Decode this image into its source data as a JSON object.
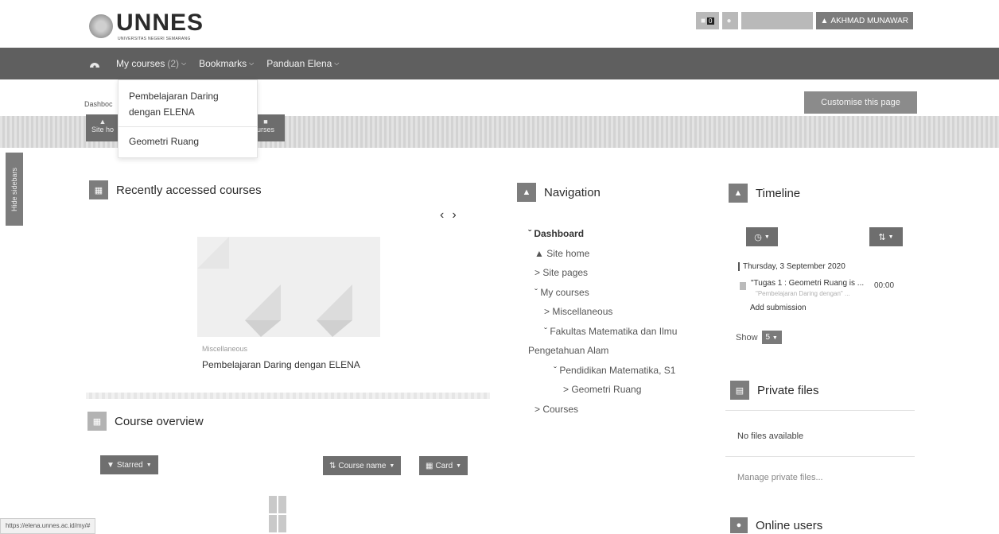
{
  "header": {
    "logo_word": "UNNES",
    "logo_sub": "UNIVERSITAS NEGERI SEMARANG",
    "notification_count": "0",
    "user_name": "AKHMAD MUNAWAR"
  },
  "navbar": {
    "my_courses_label": "My courses",
    "my_courses_count": "(2)",
    "bookmarks_label": "Bookmarks",
    "panduan_label": "Panduan Elena"
  },
  "dropdown": {
    "items": [
      "Pembelajaran Daring",
      "dengan ELENA",
      "Geometri Ruang"
    ]
  },
  "breadcrumb": "Dashboc",
  "customise_button": "Customise this page",
  "quick_links": {
    "site_home": "Site ho",
    "courses": "urses"
  },
  "hide_sidebars": "Hide sidebars",
  "recently_accessed": {
    "title": "Recently accessed courses",
    "course_category": "Miscellaneous",
    "course_name": "Pembelajaran Daring dengan ELENA"
  },
  "course_overview": {
    "title": "Course overview",
    "starred_filter": "Starred",
    "sort_label": "Course name",
    "view_label": "Card"
  },
  "navigation": {
    "title": "Navigation",
    "items": [
      "Dashboard",
      "Site home",
      "Site pages",
      "My courses",
      "Miscellaneous",
      "Fakultas Matematika dan Ilmu",
      "Pengetahuan Alam",
      "Pendidikan Matematika, S1",
      "Geometri Ruang",
      "Courses"
    ]
  },
  "timeline": {
    "title": "Timeline",
    "date": "Thursday, 3 September 2020",
    "event_title": "\"Tugas 1 : Geometri Ruang is ...",
    "event_course": "\"Pembelajaran Daring dengan\" ...",
    "event_time": "00:00",
    "event_action": "Add submission",
    "show_label": "Show",
    "show_value": "5"
  },
  "private_files": {
    "title": "Private files",
    "empty_text": "No files available",
    "manage_link": "Manage private files..."
  },
  "online_users": {
    "title": "Online users"
  },
  "status_url": "https://elena.unnes.ac.id/my/#"
}
